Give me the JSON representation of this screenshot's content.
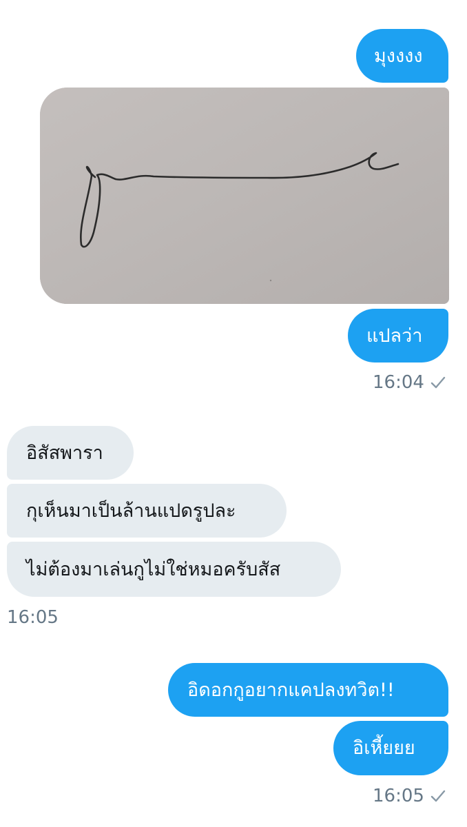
{
  "colors": {
    "outgoing_bubble": "#1da1f2",
    "incoming_bubble": "#e6ecf0",
    "timestamp_text": "#657786"
  },
  "messages": {
    "m1": "มุงงงง",
    "m2": "แปลว่า",
    "ts1": "16:04",
    "r1": "อิสัสพารา",
    "r2": "กุเห็นมาเป็นล้านแปดรูปละ",
    "r3": "ไม่ต้องมาเล่นกูไม่ใช่หมอครับสัส",
    "ts2": "16:05",
    "m3": "อิดอกกูอยากแคปลงทวิต!!",
    "m4": "อิเหี้ยยย",
    "ts3": "16:05"
  },
  "icons": {
    "read_receipt": "checkmark-icon"
  }
}
